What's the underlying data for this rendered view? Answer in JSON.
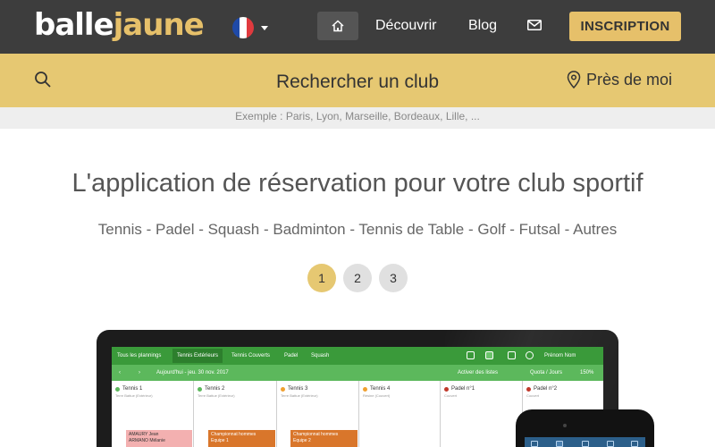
{
  "brand": {
    "part1": "balle",
    "part2": "jaune"
  },
  "nav": {
    "language": "FR",
    "discover": "Découvrir",
    "blog": "Blog",
    "signup": "INSCRIPTION"
  },
  "search": {
    "title": "Rechercher un club",
    "near_me": "Près de moi",
    "example": "Exemple : Paris, Lyon, Marseille, Bordeaux, Lille, ..."
  },
  "hero": {
    "headline": "L'application de réservation pour votre club sportif",
    "sports": "Tennis - Padel - Squash - Badminton - Tennis de Table - Golf - Futsal - Autres"
  },
  "carousel": {
    "pages": [
      "1",
      "2",
      "3"
    ],
    "active_page": "1"
  },
  "mockup": {
    "tabs": [
      "Tous les plannings",
      "Tennis Extérieurs",
      "Tennis Couverts",
      "Padel",
      "Squash"
    ],
    "active_tab": "Tennis Extérieurs",
    "date": "Aujourd'hui - jeu. 30 nov. 2017",
    "right_labels": [
      "Activer des listes",
      "Quota / Jours",
      "150%"
    ],
    "user": "Prénom Nom",
    "courts": [
      {
        "name": "Tennis 1",
        "sub": "Terre Battue (Extérieur)",
        "dot": "#5cb85c"
      },
      {
        "name": "Tennis 2",
        "sub": "Terre Battue (Extérieur)",
        "dot": "#5cb85c"
      },
      {
        "name": "Tennis 3",
        "sub": "Terre Battue (Extérieur)",
        "dot": "#f0a030"
      },
      {
        "name": "Tennis 4",
        "sub": "Résine (Couvert)",
        "dot": "#f0a030"
      },
      {
        "name": "Padel n°1",
        "sub": "Couvert",
        "dot": "#c0392b"
      },
      {
        "name": "Padel n°2",
        "sub": "Couvert",
        "dot": "#c0392b"
      }
    ],
    "bookings": [
      {
        "label": "AMAURY Jean\nARMANO Mélanie",
        "style": "pink"
      },
      {
        "label": "Championnat hommes\nEquipe 1",
        "style": "orange"
      },
      {
        "label": "Championnat hommes\nEquipe 2",
        "style": "orange"
      }
    ]
  },
  "colors": {
    "nav_bg": "#3d3d3d",
    "accent": "#e6c872",
    "brand_yellow": "#e6c06a",
    "app_green": "#5cb85c"
  }
}
